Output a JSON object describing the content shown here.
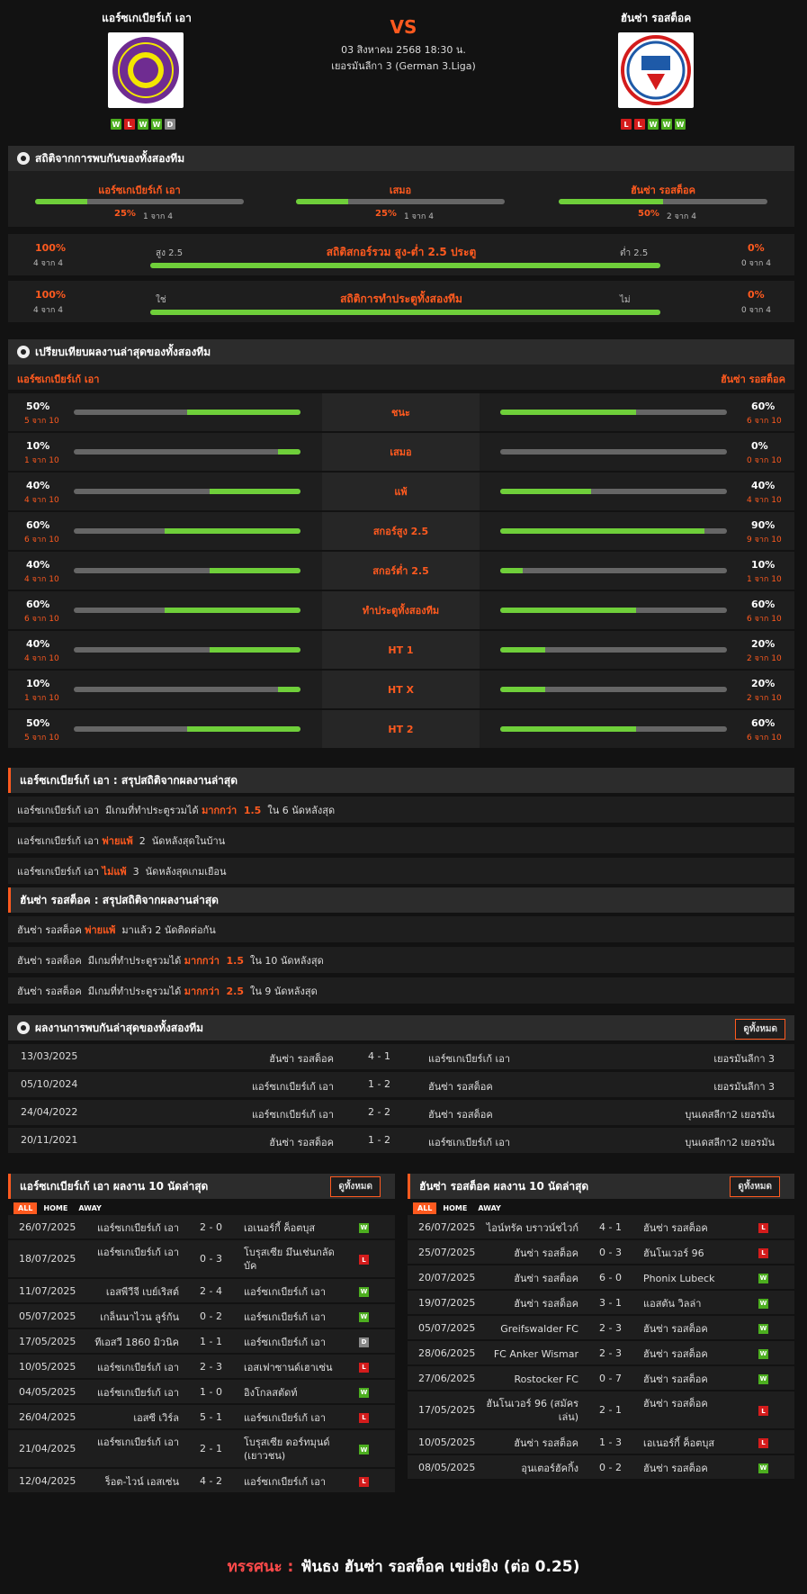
{
  "header": {
    "home_name": "แอร์ซเกเบียร์เก้ เอา",
    "away_name": "ฮันซ่า รอสต็อค",
    "vs": "VS",
    "datetime": "03 สิงหาคม 2568 18:30 น.",
    "league": "เยอรมันลีกา 3 (German 3.Liga)",
    "home_form": [
      "W",
      "L",
      "W",
      "W",
      "D"
    ],
    "away_form": [
      "L",
      "L",
      "W",
      "W",
      "W"
    ],
    "home_logo_text": "FC ERZGEBIRGE AUE",
    "away_logo_text": "F.C. HANSA"
  },
  "h2h_stats": {
    "title": "สถิติจากการพบกันของทั้งสองทีม",
    "cols": [
      {
        "label": "แอร์ซเกเบียร์เก้ เอา",
        "pct": "25%",
        "sub": "1 จาก 4",
        "value": 0.25
      },
      {
        "label": "เสมอ",
        "pct": "25%",
        "sub": "1 จาก 4",
        "value": 0.25
      },
      {
        "label": "ฮันซ่า รอสต็อค",
        "pct": "50%",
        "sub": "2 จาก 4",
        "value": 0.5
      }
    ],
    "rows": [
      {
        "lp": "100%",
        "ls": "4 จาก 4",
        "ltag": "สูง 2.5",
        "title": "สถิติสกอร์รวม สูง-ต่ำ 2.5 ประตู",
        "rtag": "ต่ำ 2.5",
        "rp": "0%",
        "rs": "0 จาก 4",
        "value": 1.0
      },
      {
        "lp": "100%",
        "ls": "4 จาก 4",
        "ltag": "ใช่",
        "title": "สถิติการทำประตูทั้งสองทีม",
        "rtag": "ไม่",
        "rp": "0%",
        "rs": "0 จาก 4",
        "value": 1.0
      }
    ]
  },
  "compare": {
    "title": "เปรียบเทียบผลงานล่าสุดของทั้งสองทีม",
    "home": "แอร์ซเกเบียร์เก้ เอา",
    "away": "ฮันซ่า รอสต็อค",
    "rows": [
      {
        "label": "ชนะ",
        "hp": "50%",
        "hs": "5 จาก 10",
        "hv": 0.5,
        "ap": "60%",
        "as": "6 จาก 10",
        "av": 0.6
      },
      {
        "label": "เสมอ",
        "hp": "10%",
        "hs": "1 จาก 10",
        "hv": 0.1,
        "ap": "0%",
        "as": "0 จาก 10",
        "av": 0.0
      },
      {
        "label": "แพ้",
        "hp": "40%",
        "hs": "4 จาก 10",
        "hv": 0.4,
        "ap": "40%",
        "as": "4 จาก 10",
        "av": 0.4
      },
      {
        "label": "สกอร์สูง 2.5",
        "hp": "60%",
        "hs": "6 จาก 10",
        "hv": 0.6,
        "ap": "90%",
        "as": "9 จาก 10",
        "av": 0.9
      },
      {
        "label": "สกอร์ต่ำ 2.5",
        "hp": "40%",
        "hs": "4 จาก 10",
        "hv": 0.4,
        "ap": "10%",
        "as": "1 จาก 10",
        "av": 0.1
      },
      {
        "label": "ทำประตูทั้งสองทีม",
        "hp": "60%",
        "hs": "6 จาก 10",
        "hv": 0.6,
        "ap": "60%",
        "as": "6 จาก 10",
        "av": 0.6
      },
      {
        "label": "HT 1",
        "hp": "40%",
        "hs": "4 จาก 10",
        "hv": 0.4,
        "ap": "20%",
        "as": "2 จาก 10",
        "av": 0.2
      },
      {
        "label": "HT X",
        "hp": "10%",
        "hs": "1 จาก 10",
        "hv": 0.1,
        "ap": "20%",
        "as": "2 จาก 10",
        "av": 0.2
      },
      {
        "label": "HT 2",
        "hp": "50%",
        "hs": "5 จาก 10",
        "hv": 0.5,
        "ap": "60%",
        "as": "6 จาก 10",
        "av": 0.6
      }
    ]
  },
  "home_summary": {
    "title": "แอร์ซเกเบียร์เก้ เอา : สรุปสถิติจากผลงานล่าสุด",
    "lines": [
      {
        "a": "แอร์ซเกเบียร์เก้ เอา  มีเกมที่ทำประตูรวมได้ ",
        "b": "มากกว่า  1.5",
        "c": "  ใน 6 นัดหลังสุด"
      },
      {
        "a": "แอร์ซเกเบียร์เก้ เอา ",
        "b": "พ่ายแพ้",
        "c": "  2  นัดหลังสุดในบ้าน"
      },
      {
        "a": "แอร์ซเกเบียร์เก้ เอา ",
        "b": "ไม่แพ้",
        "c": "  3  นัดหลังสุดเกมเยือน"
      }
    ]
  },
  "away_summary": {
    "title": "ฮันซ่า รอสต็อค : สรุปสถิติจากผลงานล่าสุด",
    "lines": [
      {
        "a": "ฮันซ่า รอสต็อค ",
        "b": "พ่ายแพ้",
        "c": "  มาแล้ว 2 นัดติดต่อกัน"
      },
      {
        "a": "ฮันซ่า รอสต็อค  มีเกมที่ทำประตูรวมได้ ",
        "b": "มากกว่า  1.5",
        "c": "  ใน 10 นัดหลังสุด"
      },
      {
        "a": "ฮันซ่า รอสต็อค  มีเกมที่ทำประตูรวมได้ ",
        "b": "มากกว่า  2.5",
        "c": "  ใน 9 นัดหลังสุด"
      }
    ]
  },
  "h2h": {
    "title": "ผลงานการพบกันล่าสุดของทั้งสองทีม",
    "view_all": "ดูทั้งหมด",
    "rows": [
      {
        "date": "13/03/2025",
        "home": "ฮันซ่า รอสต็อค",
        "score": "4 - 1",
        "away": "แอร์ซเกเบียร์เก้ เอา",
        "league": "เยอรมันลีกา 3"
      },
      {
        "date": "05/10/2024",
        "home": "แอร์ซเกเบียร์เก้ เอา",
        "score": "1 - 2",
        "away": "ฮันซ่า รอสต็อค",
        "league": "เยอรมันลีกา 3"
      },
      {
        "date": "24/04/2022",
        "home": "แอร์ซเกเบียร์เก้ เอา",
        "score": "2 - 2",
        "away": "ฮันซ่า รอสต็อค",
        "league": "บุนเดสลีกา2 เยอรมัน"
      },
      {
        "date": "20/11/2021",
        "home": "ฮันซ่า รอสต็อค",
        "score": "1 - 2",
        "away": "แอร์ซเกเบียร์เก้ เอา",
        "league": "บุนเดสลีกา2 เยอรมัน"
      }
    ]
  },
  "home_last": {
    "title": "แอร์ซเกเบียร์เก้ เอา ผลงาน 10 นัดล่าสุด",
    "view_all": "ดูทั้งหมด",
    "tabs": [
      "ALL",
      "HOME",
      "AWAY"
    ],
    "rows": [
      {
        "date": "26/07/2025",
        "home": "แอร์ซเกเบียร์เก้ เอา",
        "score": "2 - 0",
        "away": "เอเนอร์กี้ ค็อตบุส",
        "r": "W"
      },
      {
        "date": "18/07/2025",
        "home": "แอร์ซเกเบียร์เก้ เอา",
        "score": "0 - 3",
        "away": "โบรุสเซีย มึนเช่นกลัดบัค",
        "r": "L"
      },
      {
        "date": "11/07/2025",
        "home": "เอสพีวีจี เบย์เริสต์",
        "score": "2 - 4",
        "away": "แอร์ซเกเบียร์เก้ เอา",
        "r": "W"
      },
      {
        "date": "05/07/2025",
        "home": "เกล็นนาไวน ลูร์กัน",
        "score": "0 - 2",
        "away": "แอร์ซเกเบียร์เก้ เอา",
        "r": "W"
      },
      {
        "date": "17/05/2025",
        "home": "ทีเอสวี 1860 มิวนิค",
        "score": "1 - 1",
        "away": "แอร์ซเกเบียร์เก้ เอา",
        "r": "D"
      },
      {
        "date": "10/05/2025",
        "home": "แอร์ซเกเบียร์เก้ เอา",
        "score": "2 - 3",
        "away": "เอสเฟาซานด์เฮาเซ่น",
        "r": "L"
      },
      {
        "date": "04/05/2025",
        "home": "แอร์ซเกเบียร์เก้ เอา",
        "score": "1 - 0",
        "away": "อิงโกลสตัดท์",
        "r": "W"
      },
      {
        "date": "26/04/2025",
        "home": "เอสซี เวิร์ล",
        "score": "5 - 1",
        "away": "แอร์ซเกเบียร์เก้ เอา",
        "r": "L"
      },
      {
        "date": "21/04/2025",
        "home": "แอร์ซเกเบียร์เก้ เอา",
        "score": "2 - 1",
        "away": "โบรุสเซีย ดอร์ทมุนด์ (เยาวชน)",
        "r": "W"
      },
      {
        "date": "12/04/2025",
        "home": "ร็อต-ไวน์ เอสเซ่น",
        "score": "4 - 2",
        "away": "แอร์ซเกเบียร์เก้ เอา",
        "r": "L"
      }
    ]
  },
  "away_last": {
    "title": "ฮันซ่า รอสต็อค ผลงาน 10 นัดล่าสุด",
    "view_all": "ดูทั้งหมด",
    "tabs": [
      "ALL",
      "HOME",
      "AWAY"
    ],
    "rows": [
      {
        "date": "26/07/2025",
        "home": "ไอน์ทรัค บราวน์ชไวก์",
        "score": "4 - 1",
        "away": "ฮันซ่า รอสต็อค",
        "r": "L"
      },
      {
        "date": "25/07/2025",
        "home": "ฮันซ่า รอสต็อค",
        "score": "0 - 3",
        "away": "ฮันโนเวอร์ 96",
        "r": "L"
      },
      {
        "date": "20/07/2025",
        "home": "ฮันซ่า รอสต็อค",
        "score": "6 - 0",
        "away": "Phonix Lubeck",
        "r": "W"
      },
      {
        "date": "19/07/2025",
        "home": "ฮันซ่า รอสต็อค",
        "score": "3 - 1",
        "away": "แอสตัน วิลล่า",
        "r": "W"
      },
      {
        "date": "05/07/2025",
        "home": "Greifswalder FC",
        "score": "2 - 3",
        "away": "ฮันซ่า รอสต็อค",
        "r": "W"
      },
      {
        "date": "28/06/2025",
        "home": "FC Anker Wismar",
        "score": "2 - 3",
        "away": "ฮันซ่า รอสต็อค",
        "r": "W"
      },
      {
        "date": "27/06/2025",
        "home": "Rostocker FC",
        "score": "0 - 7",
        "away": "ฮันซ่า รอสต็อค",
        "r": "W"
      },
      {
        "date": "17/05/2025",
        "home": "ฮันโนเวอร์ 96 (สมัครเล่น)",
        "score": "2 - 1",
        "away": "ฮันซ่า รอสต็อค",
        "r": "L"
      },
      {
        "date": "10/05/2025",
        "home": "ฮันซ่า รอสต็อค",
        "score": "1 - 3",
        "away": "เอเนอร์กี้ ค็อตบุส",
        "r": "L"
      },
      {
        "date": "08/05/2025",
        "home": "อุนเตอร์ฮัคกิ้ง",
        "score": "0 - 2",
        "away": "ฮันซ่า รอสต็อค",
        "r": "W"
      }
    ]
  },
  "tip": {
    "label": "ทรรศนะ :",
    "text": "ฟันธง ฮันซ่า รอสต็อค เขย่งยิง (ต่อ 0.25)"
  },
  "colors": {
    "accent": "#ff5a1f",
    "green": "#6fcf3a",
    "win": "#4cae1f",
    "loss": "#d41c1c",
    "draw": "#888888"
  }
}
